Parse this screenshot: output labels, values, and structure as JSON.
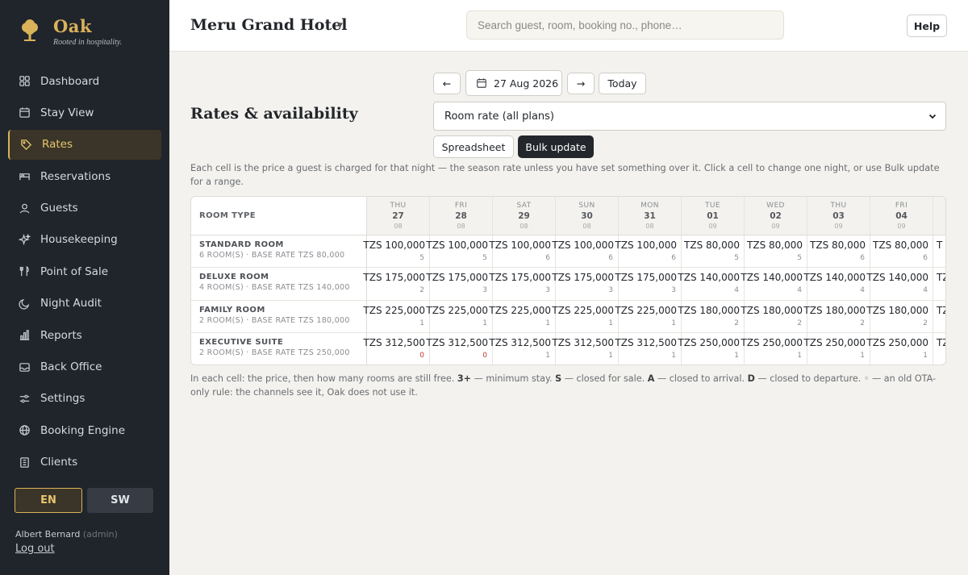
{
  "brand": {
    "name": "Oak",
    "tagline": "Rooted in hospitality."
  },
  "nav": [
    {
      "label": "Dashboard",
      "icon": "grid-icon",
      "active": false
    },
    {
      "label": "Stay View",
      "icon": "calendar-icon",
      "active": false
    },
    {
      "label": "Rates",
      "icon": "tag-icon",
      "active": true
    },
    {
      "label": "Reservations",
      "icon": "bed-icon",
      "active": false
    },
    {
      "label": "Guests",
      "icon": "user-icon",
      "active": false
    },
    {
      "label": "Housekeeping",
      "icon": "sparkle-icon",
      "active": false
    },
    {
      "label": "Point of Sale",
      "icon": "utensils-icon",
      "active": false
    },
    {
      "label": "Night Audit",
      "icon": "moon-icon",
      "active": false
    },
    {
      "label": "Reports",
      "icon": "bar-chart-icon",
      "active": false
    },
    {
      "label": "Back Office",
      "icon": "inbox-icon",
      "active": false
    },
    {
      "label": "Settings",
      "icon": "sliders-icon",
      "active": false
    },
    {
      "label": "Booking Engine",
      "icon": "globe-icon",
      "active": false
    },
    {
      "label": "Clients",
      "icon": "building-icon",
      "active": false
    }
  ],
  "language": {
    "en": "EN",
    "sw": "SW",
    "selected": "EN"
  },
  "user": {
    "name": "Albert Bernard",
    "role": "(admin)",
    "logout": "Log out"
  },
  "header": {
    "hotel_name": "Meru Grand Hotel",
    "search_placeholder": "Search guest, room, booking no., phone…",
    "help": "Help"
  },
  "main": {
    "title": "Rates & availability",
    "prev": "←",
    "next": "→",
    "date": "27 Aug 2026",
    "today": "Today",
    "rate_select": "Room rate (all plans)",
    "tab_spreadsheet": "Spreadsheet",
    "tab_bulk": "Bulk update",
    "description": "Each cell is the price a guest is charged for that night — the season rate unless you have set something over it. Click a cell to change one night, or use Bulk update for a range.",
    "legend_parts": [
      {
        "text": "In each cell: the price, then how many rooms are still free. ",
        "bold": false
      },
      {
        "text": "3+",
        "bold": true
      },
      {
        "text": " — minimum stay. ",
        "bold": false
      },
      {
        "text": "S",
        "bold": true
      },
      {
        "text": " — closed for sale. ",
        "bold": false
      },
      {
        "text": "A",
        "bold": true
      },
      {
        "text": " — closed to arrival. ",
        "bold": false
      },
      {
        "text": "D",
        "bold": true
      },
      {
        "text": " — closed to departure. ◦ — an old OTA-only rule: the channels see it, Oak does not use it.",
        "bold": false
      }
    ]
  },
  "grid": {
    "room_type_header": "ROOM TYPE",
    "days": [
      {
        "dow": "THU",
        "date": "27",
        "month": "08"
      },
      {
        "dow": "FRI",
        "date": "28",
        "month": "08"
      },
      {
        "dow": "SAT",
        "date": "29",
        "month": "08"
      },
      {
        "dow": "SUN",
        "date": "30",
        "month": "08"
      },
      {
        "dow": "MON",
        "date": "31",
        "month": "08"
      },
      {
        "dow": "TUE",
        "date": "01",
        "month": "09"
      },
      {
        "dow": "WED",
        "date": "02",
        "month": "09"
      },
      {
        "dow": "THU",
        "date": "03",
        "month": "09"
      },
      {
        "dow": "FRI",
        "date": "04",
        "month": "09"
      },
      {
        "dow": "",
        "date": "",
        "month": ""
      }
    ],
    "rooms": [
      {
        "name": "STANDARD ROOM",
        "meta": "6 ROOM(S) · BASE RATE TZS 80,000",
        "cells": [
          {
            "price": "TZS 100,000",
            "avail": "5"
          },
          {
            "price": "TZS 100,000",
            "avail": "5"
          },
          {
            "price": "TZS 100,000",
            "avail": "6"
          },
          {
            "price": "TZS 100,000",
            "avail": "6"
          },
          {
            "price": "TZS 100,000",
            "avail": "6"
          },
          {
            "price": "TZS 80,000",
            "avail": "5"
          },
          {
            "price": "TZS 80,000",
            "avail": "5"
          },
          {
            "price": "TZS 80,000",
            "avail": "6"
          },
          {
            "price": "TZS 80,000",
            "avail": "6"
          },
          {
            "price": "T",
            "avail": ""
          }
        ]
      },
      {
        "name": "DELUXE ROOM",
        "meta": "4 ROOM(S) · BASE RATE TZS 140,000",
        "cells": [
          {
            "price": "TZS 175,000",
            "avail": "2"
          },
          {
            "price": "TZS 175,000",
            "avail": "3"
          },
          {
            "price": "TZS 175,000",
            "avail": "3"
          },
          {
            "price": "TZS 175,000",
            "avail": "3"
          },
          {
            "price": "TZS 175,000",
            "avail": "3"
          },
          {
            "price": "TZS 140,000",
            "avail": "4"
          },
          {
            "price": "TZS 140,000",
            "avail": "4"
          },
          {
            "price": "TZS 140,000",
            "avail": "4"
          },
          {
            "price": "TZS 140,000",
            "avail": "4"
          },
          {
            "price": "TZ",
            "avail": ""
          }
        ]
      },
      {
        "name": "FAMILY ROOM",
        "meta": "2 ROOM(S) · BASE RATE TZS 180,000",
        "cells": [
          {
            "price": "TZS 225,000",
            "avail": "1"
          },
          {
            "price": "TZS 225,000",
            "avail": "1"
          },
          {
            "price": "TZS 225,000",
            "avail": "1"
          },
          {
            "price": "TZS 225,000",
            "avail": "1"
          },
          {
            "price": "TZS 225,000",
            "avail": "1"
          },
          {
            "price": "TZS 180,000",
            "avail": "2"
          },
          {
            "price": "TZS 180,000",
            "avail": "2"
          },
          {
            "price": "TZS 180,000",
            "avail": "2"
          },
          {
            "price": "TZS 180,000",
            "avail": "2"
          },
          {
            "price": "TZ",
            "avail": ""
          }
        ]
      },
      {
        "name": "EXECUTIVE SUITE",
        "meta": "2 ROOM(S) · BASE RATE TZS 250,000",
        "cells": [
          {
            "price": "TZS 312,500",
            "avail": "0"
          },
          {
            "price": "TZS 312,500",
            "avail": "0"
          },
          {
            "price": "TZS 312,500",
            "avail": "1"
          },
          {
            "price": "TZS 312,500",
            "avail": "1"
          },
          {
            "price": "TZS 312,500",
            "avail": "1"
          },
          {
            "price": "TZS 250,000",
            "avail": "1"
          },
          {
            "price": "TZS 250,000",
            "avail": "1"
          },
          {
            "price": "TZS 250,000",
            "avail": "1"
          },
          {
            "price": "TZS 250,000",
            "avail": "1"
          },
          {
            "price": "TZ",
            "avail": ""
          }
        ]
      }
    ]
  },
  "colors": {
    "accent": "#d9b25a",
    "sidebar": "#20242b",
    "unavailable": "#c0392b"
  }
}
